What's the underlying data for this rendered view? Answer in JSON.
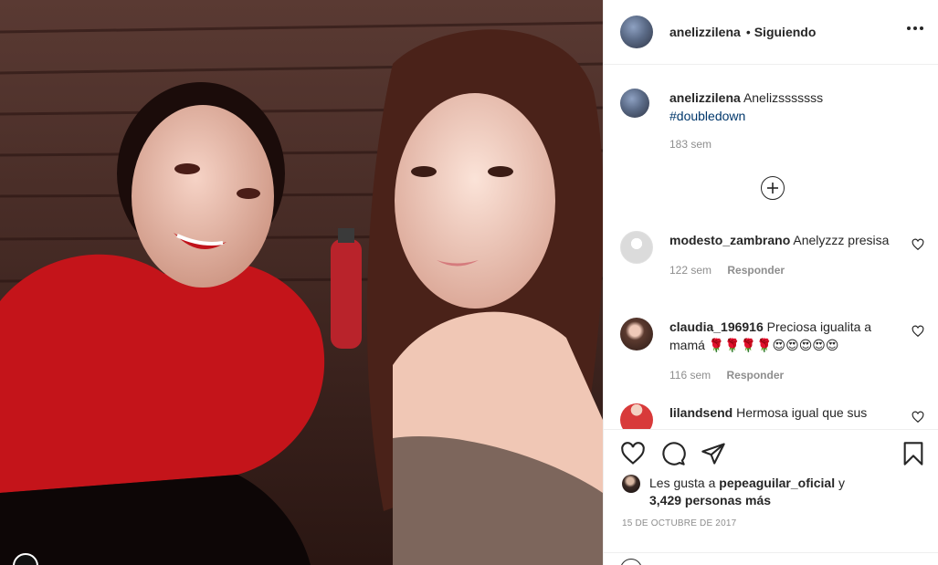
{
  "post": {
    "username": "anelizzilena",
    "follow_status": "Siguiendo",
    "caption_text": "Anelizsssssss",
    "caption_hashtag": "#doubledown",
    "caption_age": "183 sem"
  },
  "comments": [
    {
      "username": "modesto_zambrano",
      "text": "Anelyzzz presisa",
      "age": "122 sem",
      "reply_label": "Responder"
    },
    {
      "username": "claudia_196916",
      "text": "Preciosa igualita a mamá 🌹🌹🌹🌹😍😍😍😍😍",
      "age": "116 sem",
      "reply_label": "Responder"
    },
    {
      "username": "lilandsend",
      "text": "Hermosa igual que sus"
    }
  ],
  "likes": {
    "prefix": "Les gusta a",
    "liker": "pepeaguilar_oficial",
    "joiner": "y",
    "count_text": "3,429 personas más"
  },
  "date": "15 DE OCTUBRE DE 2017",
  "icons": {
    "more": "more-horizontal-icon",
    "load_more": "plus-circle-icon",
    "like": "heart-icon",
    "comment": "comment-icon",
    "share": "paper-plane-icon",
    "save": "bookmark-icon"
  },
  "colors": {
    "text": "#262626",
    "muted": "#8e8e8e",
    "hashtag": "#00376b",
    "border": "#efefef"
  }
}
